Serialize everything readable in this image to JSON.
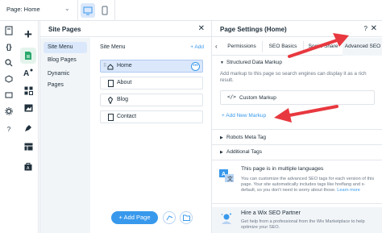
{
  "topbar": {
    "page_label": "Page: Home"
  },
  "site_pages": {
    "title": "Site Pages",
    "nav": [
      "Site Menu",
      "Blog Pages",
      "Dynamic Pages"
    ],
    "menu_title": "Site Menu",
    "add_label": "+ Add",
    "pages": [
      "Home",
      "About",
      "Blog",
      "Contact"
    ],
    "add_page_label": "+ Add Page"
  },
  "page_settings": {
    "title": "Page Settings (Home)",
    "help": "?",
    "tabs": [
      "Permissions",
      "SEO Basics",
      "Social Share",
      "Advanced SEO"
    ],
    "structured_data": {
      "heading": "Structured Data Markup",
      "description": "Add markup to this page so search engines can display it as a rich result.",
      "custom_markup": "Custom Markup",
      "add_new": "+ Add New Markup"
    },
    "robots_heading": "Robots Meta Tag",
    "additional_tags_heading": "Additional Tags",
    "languages": {
      "title": "This page is in multiple languages",
      "text": "You can customize the advanced SEO tags for each version of this page. Your site automatically includes tags like hreflang and x-default, so you don't need to worry about those.",
      "link": "Learn more"
    },
    "partner": {
      "title": "Hire a Wix SEO Partner",
      "text": "Get help from a professional from the Wix Marketplace to help optimize your SEO."
    }
  },
  "colors": {
    "accent": "#3899ec",
    "annotation_arrow": "#e8383f",
    "active_bg": "#dbe8fb"
  },
  "icons": [
    "desktop-icon",
    "mobile-icon",
    "pages-icon",
    "add-icon",
    "close-icon",
    "help-icon",
    "gear-icon",
    "drag-handle-icon",
    "more-icon",
    "home-page-icon",
    "page-icon",
    "blog-icon",
    "translate-icon",
    "partner-icon"
  ]
}
